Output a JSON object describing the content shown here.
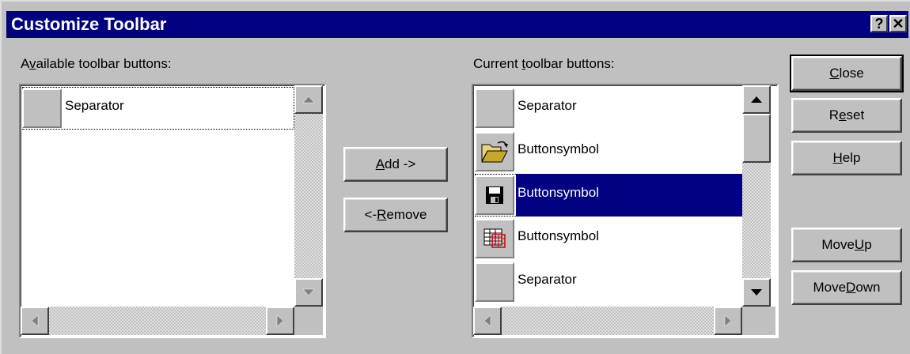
{
  "window": {
    "title": "Customize Toolbar",
    "help_button": "?",
    "close_button": "✕"
  },
  "available": {
    "label_pre": "A",
    "label_key": "v",
    "label_post": "ailable toolbar buttons:",
    "items": [
      {
        "label": "Separator",
        "icon": "blank"
      }
    ]
  },
  "current": {
    "label_pre": "Current ",
    "label_key": "t",
    "label_post": "oolbar buttons:",
    "items": [
      {
        "label": "Separator",
        "icon": "blank"
      },
      {
        "label": "Buttonsymbol",
        "icon": "open-folder-icon"
      },
      {
        "label": "Buttonsymbol",
        "icon": "floppy-disk-icon",
        "selected": true
      },
      {
        "label": "Buttonsymbol",
        "icon": "table-grid-icon"
      },
      {
        "label": "Separator",
        "icon": "blank"
      }
    ]
  },
  "buttons": {
    "add": {
      "pre": "",
      "key": "A",
      "post": "dd ->"
    },
    "remove": {
      "pre": "<- ",
      "key": "R",
      "post": "emove"
    },
    "close": {
      "pre": "",
      "key": "C",
      "post": "lose"
    },
    "reset": {
      "pre": "R",
      "key": "e",
      "post": "set"
    },
    "help": {
      "pre": "",
      "key": "H",
      "post": "elp"
    },
    "move_up": {
      "pre": "Move ",
      "key": "U",
      "post": "p"
    },
    "move_down": {
      "pre": "Move ",
      "key": "D",
      "post": "own"
    }
  },
  "colors": {
    "title_bg": "#000080",
    "face": "#c0c0c0",
    "selection": "#000080"
  }
}
